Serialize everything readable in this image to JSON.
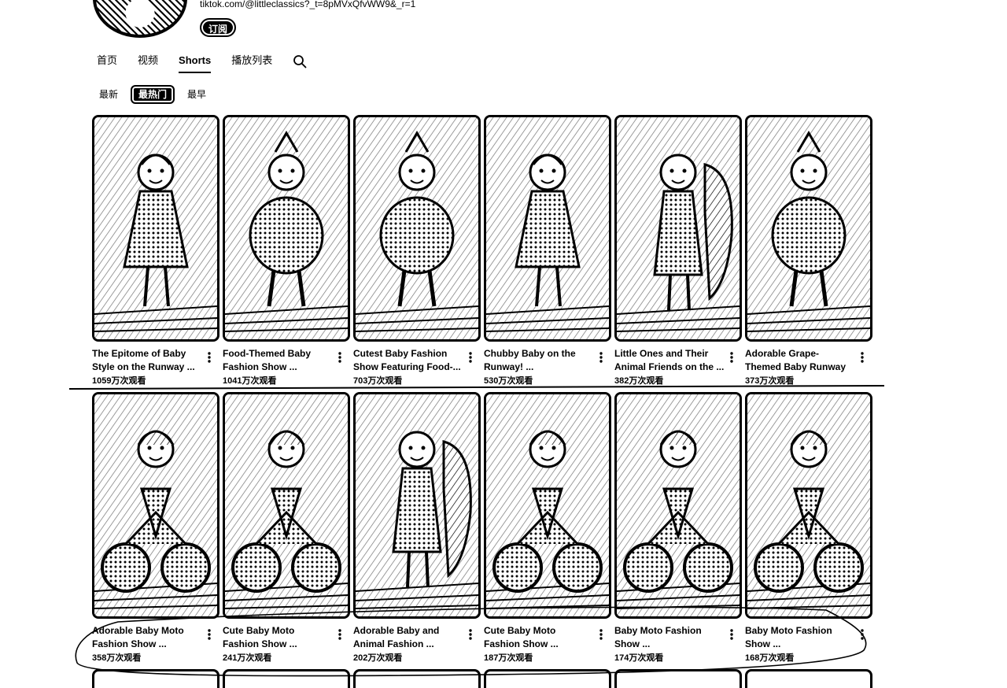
{
  "channel": {
    "link": "tiktok.com/@littleclassics?_t=8pMVxQfvWW9&_r=1",
    "subscribe_label": "订阅"
  },
  "tabs": [
    {
      "label": "首页",
      "active": false
    },
    {
      "label": "视频",
      "active": false
    },
    {
      "label": "Shorts",
      "active": true
    },
    {
      "label": "播放列表",
      "active": false
    }
  ],
  "filters": [
    {
      "label": "最新",
      "active": false
    },
    {
      "label": "最热门",
      "active": true
    },
    {
      "label": "最早",
      "active": false
    }
  ],
  "shorts": [
    {
      "title": "The Epitome of Baby Style on the  Runway ...",
      "views": "1059万次观看",
      "icon": "child-runway"
    },
    {
      "title": "Food-Themed Baby Fashion Show ...",
      "views": "1041万次观看",
      "icon": "food-costume"
    },
    {
      "title": "Cutest Baby Fashion Show Featuring Food-...",
      "views": "703万次观看",
      "icon": "food-costume"
    },
    {
      "title": "Chubby Baby on the Runway! ...",
      "views": "530万次观看",
      "icon": "child-runway"
    },
    {
      "title": "Little Ones and Their Animal Friends on the ...",
      "views": "382万次观看",
      "icon": "animal-friend"
    },
    {
      "title": "Adorable Grape-Themed Baby Runway ...",
      "views": "373万次观看",
      "icon": "grape-costume"
    },
    {
      "title": "Adorable Baby Moto Fashion Show ...",
      "views": "358万次观看",
      "icon": "motorcycle"
    },
    {
      "title": "Cute Baby Moto Fashion Show ...",
      "views": "241万次观看",
      "icon": "motorcycle"
    },
    {
      "title": "Adorable Baby and Animal Fashion ...",
      "views": "202万次观看",
      "icon": "animal-friend"
    },
    {
      "title": "Cute Baby Moto Fashion Show ...",
      "views": "187万次观看",
      "icon": "motorcycle"
    },
    {
      "title": "Baby Moto Fashion Show ...",
      "views": "174万次观看",
      "icon": "motorcycle"
    },
    {
      "title": "Baby Moto Fashion Show ...",
      "views": "168万次观看",
      "icon": "motorcycle"
    }
  ]
}
